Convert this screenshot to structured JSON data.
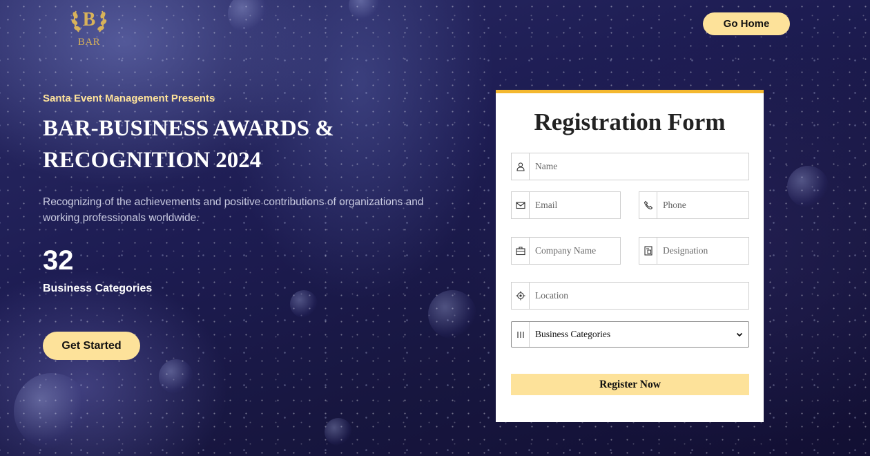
{
  "logo": {
    "text": "BAR",
    "letter": "B"
  },
  "nav": {
    "go_home_label": "Go Home"
  },
  "hero": {
    "presents": "Santa Event Management Presents",
    "title": "BAR-BUSINESS AWARDS & RECOGNITION 2024",
    "description": "Recognizing of the achievements and positive contributions of organizations and working professionals worldwide.",
    "stat_number": "32",
    "stat_label": "Business Categories",
    "cta_label": "Get Started"
  },
  "form": {
    "title": "Registration Form",
    "fields": {
      "name": {
        "placeholder": "Name",
        "icon": "user-icon"
      },
      "email": {
        "placeholder": "Email",
        "icon": "envelope-icon"
      },
      "phone": {
        "placeholder": "Phone",
        "icon": "phone-icon"
      },
      "company": {
        "placeholder": "Company Name",
        "icon": "briefcase-icon"
      },
      "designation": {
        "placeholder": "Designation",
        "icon": "id-badge-icon"
      },
      "location": {
        "placeholder": "Location",
        "icon": "location-target-icon"
      },
      "category": {
        "selected": "Business Categories",
        "icon": "bars-icon"
      }
    },
    "submit_label": "Register Now"
  },
  "colors": {
    "accent": "#fde29a",
    "card_border": "#f4b830",
    "background": "#1d1c52",
    "logo_gold": "#d8b25a"
  }
}
